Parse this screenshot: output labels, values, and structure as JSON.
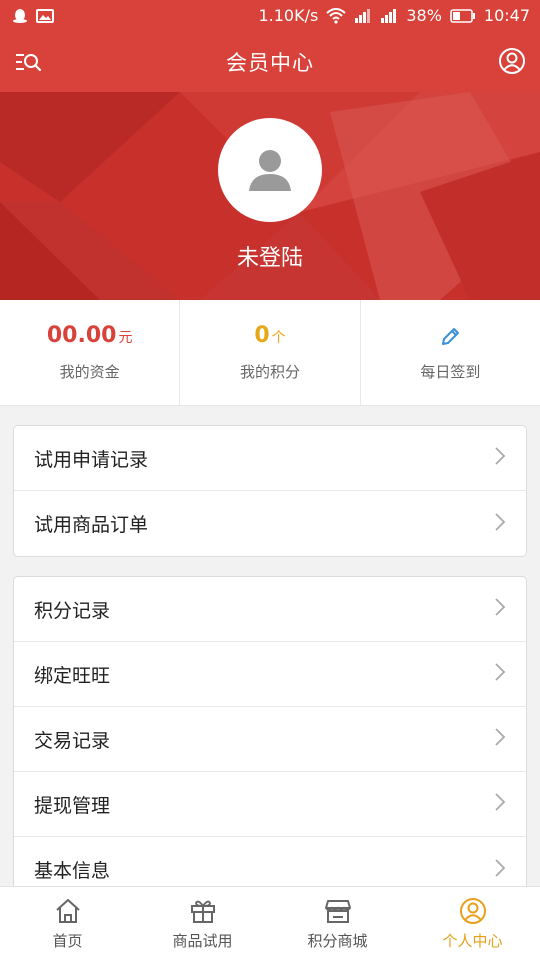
{
  "status_bar": {
    "network_speed": "1.10K/s",
    "battery": "38%",
    "time": "10:47"
  },
  "nav": {
    "title": "会员中心",
    "left_icon": "search-list-icon",
    "right_icon": "user-circle-icon"
  },
  "profile": {
    "login_status": "未登陆"
  },
  "stats": [
    {
      "value": "00.00",
      "unit": "元",
      "label": "我的资金",
      "color": "#d8423a"
    },
    {
      "value": "0",
      "unit": "个",
      "label": "我的积分",
      "color": "#e6a817"
    },
    {
      "icon": "pencil-icon",
      "label": "每日签到",
      "color": "#3b8fd6"
    }
  ],
  "menu_group_1": [
    {
      "label": "试用申请记录"
    },
    {
      "label": "试用商品订单"
    }
  ],
  "menu_group_2": [
    {
      "label": "积分记录"
    },
    {
      "label": "绑定旺旺"
    },
    {
      "label": "交易记录"
    },
    {
      "label": "提现管理"
    },
    {
      "label": "基本信息"
    }
  ],
  "tabs": [
    {
      "label": "首页",
      "icon": "home-icon",
      "active": false
    },
    {
      "label": "商品试用",
      "icon": "gift-icon",
      "active": false
    },
    {
      "label": "积分商城",
      "icon": "store-icon",
      "active": false
    },
    {
      "label": "个人中心",
      "icon": "user-circle-icon",
      "active": true
    }
  ],
  "colors": {
    "brand": "#d8423a",
    "active_tab": "#e8a01c"
  }
}
